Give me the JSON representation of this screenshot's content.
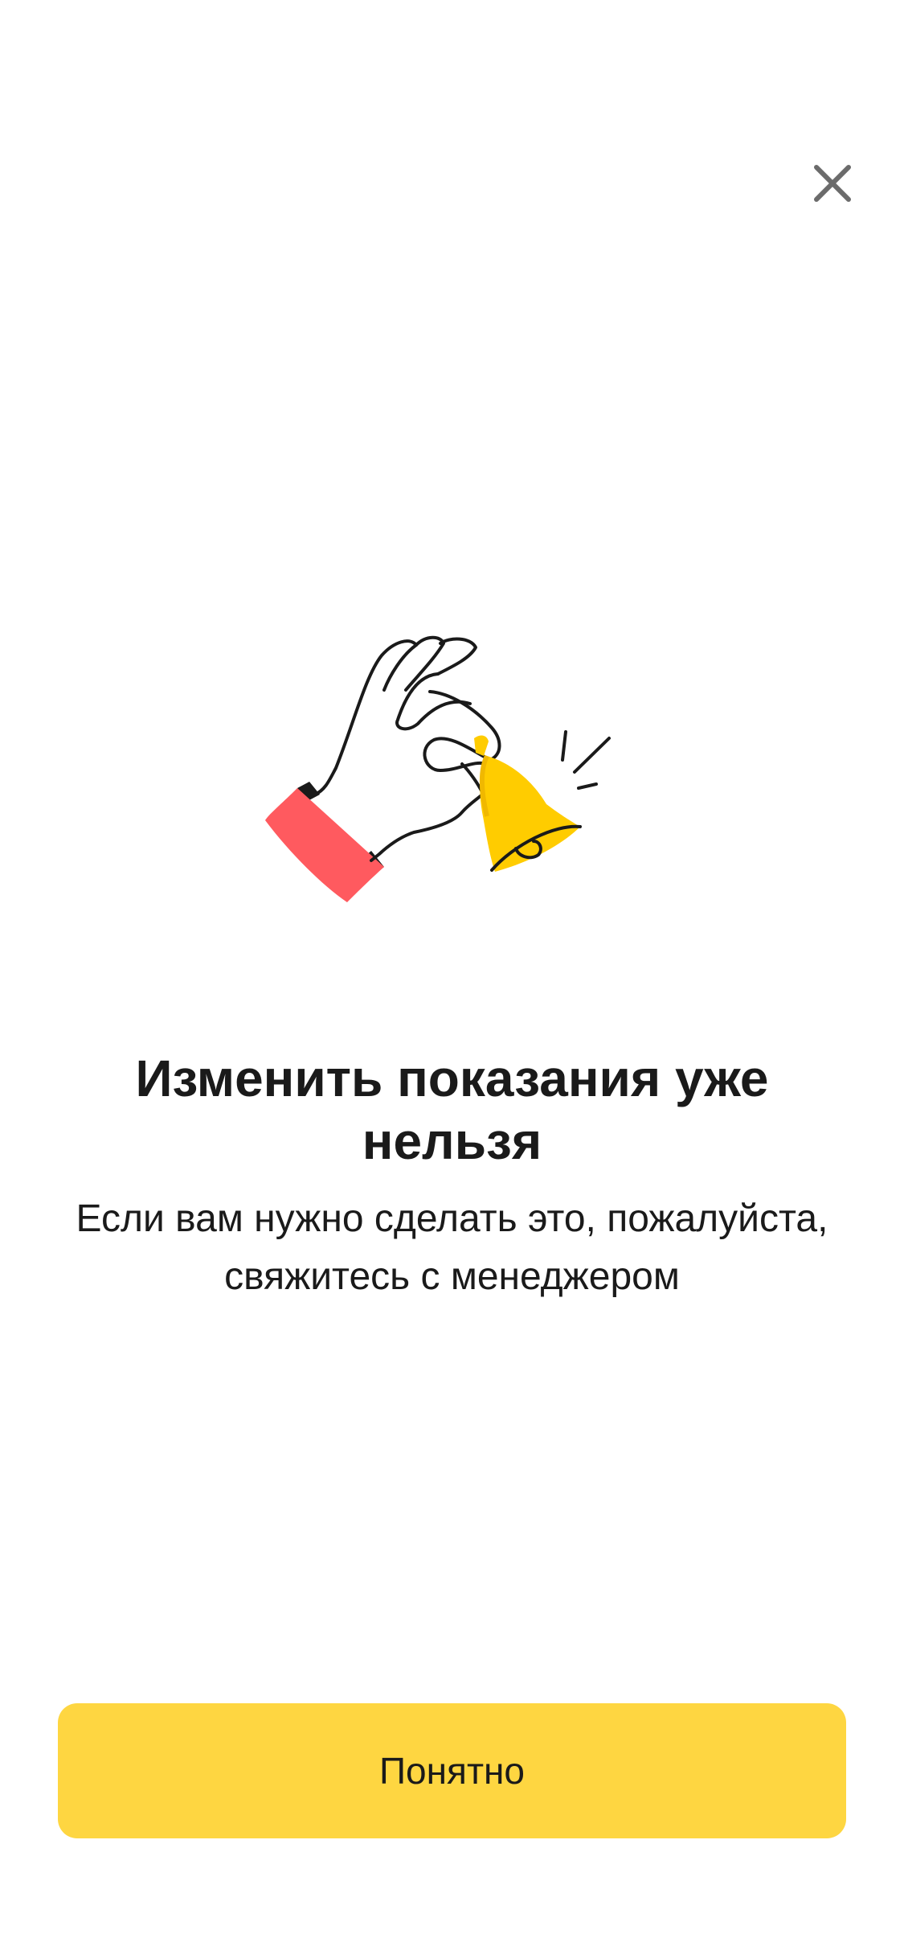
{
  "dialog": {
    "title": "Изменить показания уже нельзя",
    "message": "Если вам нужно сделать это, пожалуйста, свяжитесь с менеджером",
    "confirm_label": "Понятно",
    "close_icon": "close-icon",
    "illustration": "hand-ringing-bell-illustration"
  },
  "colors": {
    "background": "#ffffff",
    "button": "#fed641",
    "text": "#1a1a1a",
    "bell": "#ffcc00",
    "cuff": "#ff5a5f",
    "close_icon": "#6b6b6b"
  }
}
